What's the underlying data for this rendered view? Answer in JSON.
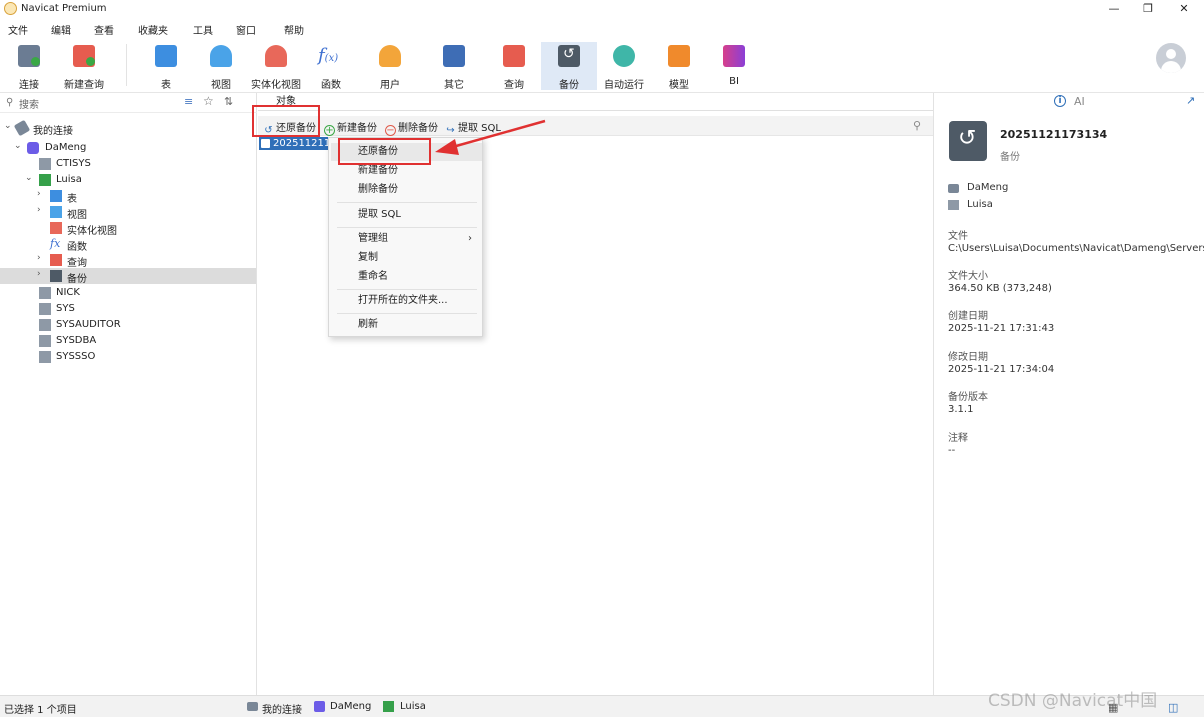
{
  "window": {
    "title": "Navicat Premium"
  },
  "menu": [
    "文件",
    "编辑",
    "查看",
    "收藏夹",
    "工具",
    "窗口",
    "帮助"
  ],
  "toolbar": {
    "buttons": [
      {
        "label": "连接"
      },
      {
        "label": "新建查询"
      },
      {
        "label": "表"
      },
      {
        "label": "视图"
      },
      {
        "label": "实体化视图"
      },
      {
        "label": "函数"
      },
      {
        "label": "用户"
      },
      {
        "label": "其它"
      },
      {
        "label": "查询"
      },
      {
        "label": "备份"
      },
      {
        "label": "自动运行"
      },
      {
        "label": "模型"
      },
      {
        "label": "BI"
      }
    ],
    "active": "备份"
  },
  "sidebar": {
    "search_placeholder": "搜索",
    "tree": [
      {
        "label": "我的连接"
      },
      {
        "label": "DaMeng"
      },
      {
        "label": "CTISYS"
      },
      {
        "label": "Luisa"
      },
      {
        "label": "表"
      },
      {
        "label": "视图"
      },
      {
        "label": "实体化视图"
      },
      {
        "label": "函数"
      },
      {
        "label": "查询"
      },
      {
        "label": "备份"
      },
      {
        "label": "NICK"
      },
      {
        "label": "SYS"
      },
      {
        "label": "SYSAUDITOR"
      },
      {
        "label": "SYSDBA"
      },
      {
        "label": "SYSSSO"
      }
    ]
  },
  "center": {
    "tab": "对象",
    "toolbar": {
      "restore": "还原备份",
      "new": "新建备份",
      "delete": "删除备份",
      "extract": "提取 SQL"
    },
    "selected_file": "20251121173134"
  },
  "context_menu": {
    "items": [
      "还原备份",
      "新建备份",
      "删除备份",
      "提取 SQL",
      "管理组",
      "复制",
      "重命名",
      "打开所在的文件夹...",
      "刷新"
    ]
  },
  "details": {
    "name": "20251121173134",
    "type": "备份",
    "connection": "DaMeng",
    "schema": "Luisa",
    "file_label": "文件",
    "file_value": "C:\\Users\\Luisa\\Documents\\Navicat\\Dameng\\Servers\\Da",
    "size_label": "文件大小",
    "size_value": "364.50 KB (373,248)",
    "created_label": "创建日期",
    "created_value": "2025-11-21 17:31:43",
    "modified_label": "修改日期",
    "modified_value": "2025-11-21 17:34:04",
    "version_label": "备份版本",
    "version_value": "3.1.1",
    "comment_label": "注释",
    "comment_value": "--"
  },
  "status": {
    "selection": "已选择 1 个项目",
    "crumb1": "我的连接",
    "crumb2": "DaMeng",
    "crumb3": "Luisa"
  },
  "watermark": "CSDN @Navicat中国",
  "colors": {
    "accent": "#2f6fb8",
    "highlight": "#e03131",
    "selected_row": "#dcdcdc",
    "active_tool": "#dfe9f6"
  }
}
